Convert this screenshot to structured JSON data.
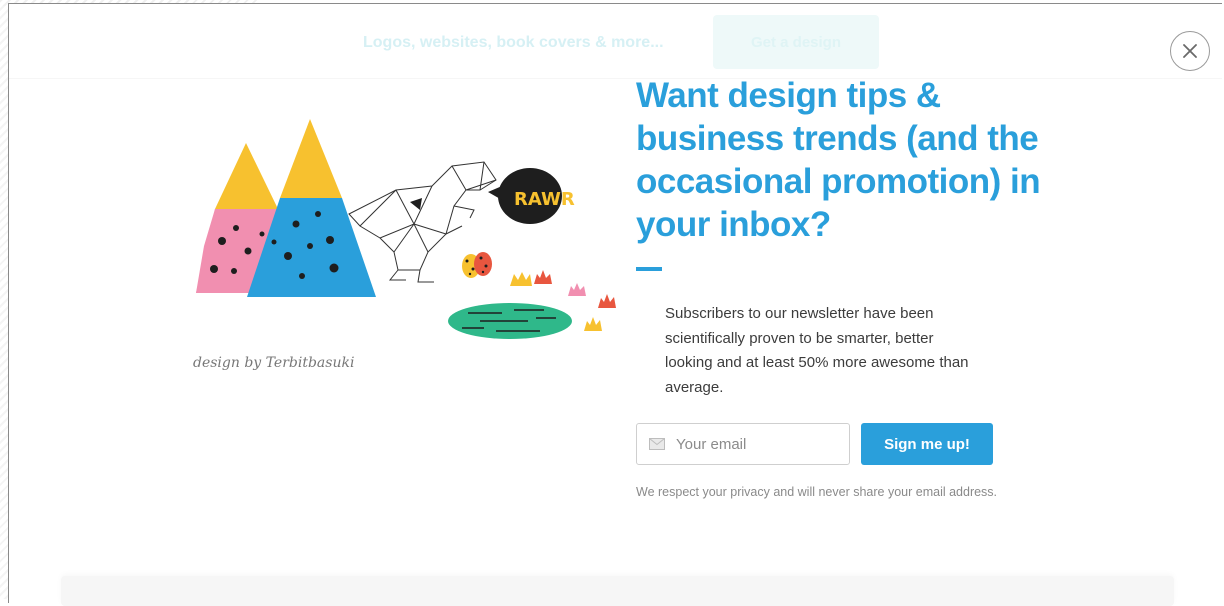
{
  "background_header": {
    "tagline": "Logos, websites, book covers & more...",
    "cta_label": "Get a design"
  },
  "illustration": {
    "speech_bubble_text": "RAWR",
    "credit": "design by Terbitbasuki"
  },
  "newsletter": {
    "headline": "Want design tips & business trends (and the occasional promotion) in your inbox?",
    "body": "Subscribers to our newsletter have been scientifically proven to be smarter, better looking and at least 50% more awesome than average.",
    "email_placeholder": "Your email",
    "email_value": "",
    "submit_label": "Sign me up!",
    "privacy_note": "We respect your privacy and will never share your email address."
  },
  "colors": {
    "brand_blue": "#2a9fdb",
    "body_text": "#3c3c3c",
    "muted_text": "#8a8a8a"
  },
  "icons": {
    "close": "close-icon",
    "email": "envelope-icon"
  }
}
